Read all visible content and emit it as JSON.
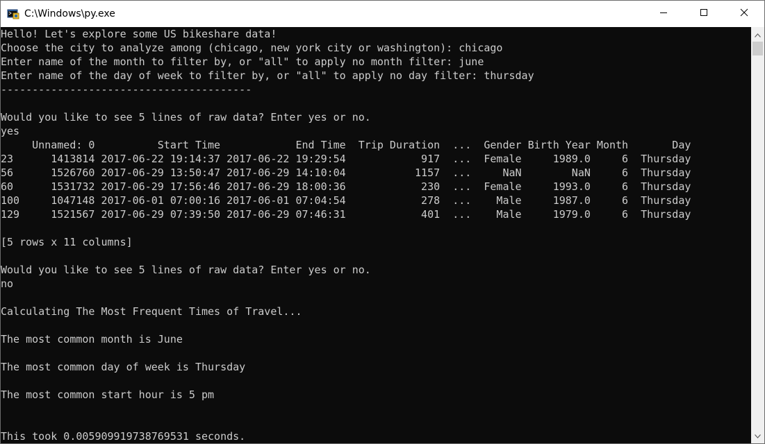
{
  "window": {
    "title": "C:\\Windows\\py.exe",
    "icon": "python-console-icon",
    "minimize_icon": "minimize-icon",
    "maximize_icon": "maximize-icon",
    "close_icon": "close-icon"
  },
  "colors": {
    "console_background": "#0c0c0c",
    "console_text": "#cccccc",
    "titlebar_background": "#ffffff",
    "scrollbar_track": "#f0f0f0",
    "scrollbar_thumb": "#cdcdcd"
  },
  "console": {
    "lines": [
      "Hello! Let's explore some US bikeshare data!",
      "Choose the city to analyze among (chicago, new york city or washington): chicago",
      "Enter name of the month to filter by, or \"all\" to apply no month filter: june",
      "Enter name of the day of week to filter by, or \"all\" to apply no day filter: thursday",
      "----------------------------------------",
      "",
      "Would you like to see 5 lines of raw data? Enter yes or no.",
      "yes",
      "     Unnamed: 0          Start Time            End Time  Trip Duration  ...  Gender Birth Year Month       Day",
      "23      1413814 2017-06-22 19:14:37 2017-06-22 19:29:54            917  ...  Female     1989.0     6  Thursday",
      "56      1526760 2017-06-29 13:50:47 2017-06-29 14:10:04           1157  ...     NaN        NaN     6  Thursday",
      "60      1531732 2017-06-29 17:56:46 2017-06-29 18:00:36            230  ...  Female     1993.0     6  Thursday",
      "100     1047148 2017-06-01 07:00:16 2017-06-01 07:04:54            278  ...    Male     1987.0     6  Thursday",
      "129     1521567 2017-06-29 07:39:50 2017-06-29 07:46:31            401  ...    Male     1979.0     6  Thursday",
      "",
      "[5 rows x 11 columns]",
      "",
      "Would you like to see 5 lines of raw data? Enter yes or no.",
      "no",
      "",
      "Calculating The Most Frequent Times of Travel...",
      "",
      "The most common month is June",
      "",
      "The most common day of week is Thursday",
      "",
      "The most common start hour is 5 pm",
      "",
      "",
      "This took 0.005909919738769531 seconds."
    ]
  },
  "scrollbar": {
    "up_icon": "scroll-up-arrow-icon",
    "down_icon": "scroll-down-arrow-icon"
  }
}
